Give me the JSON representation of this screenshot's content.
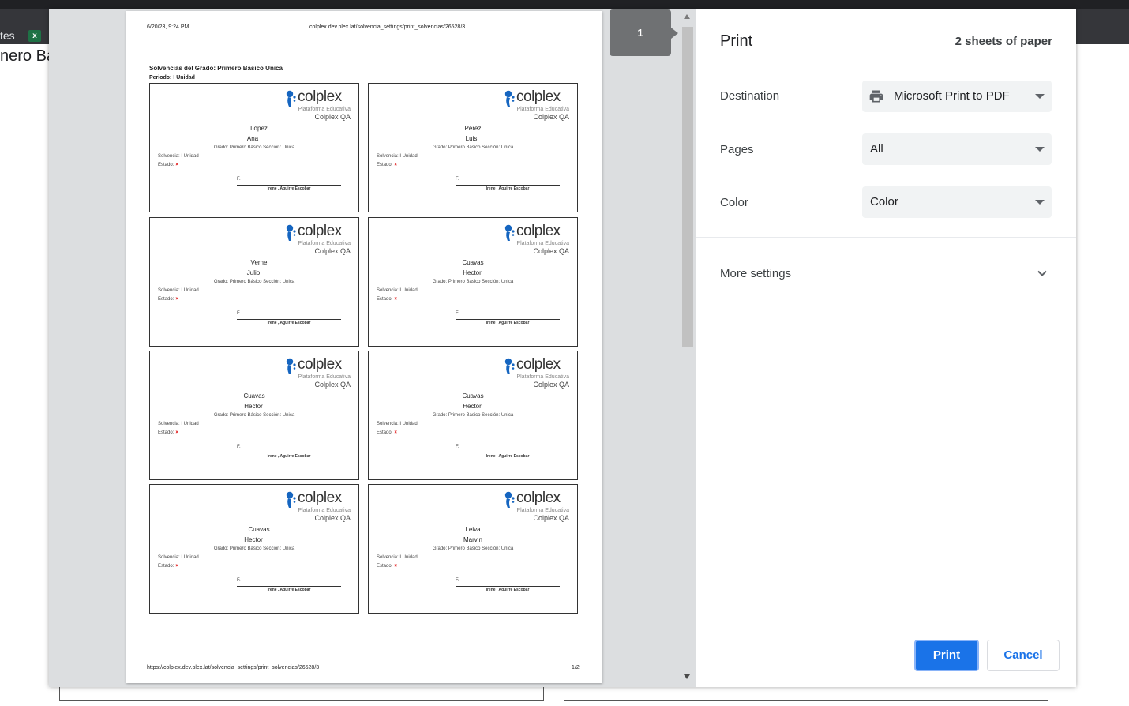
{
  "background": {
    "bookmark_text": "tes",
    "excel_icon_letter": "x",
    "heading_fragment": "nero Bá"
  },
  "preview": {
    "header_date": "6/20/23, 9:24 PM",
    "header_url": "colplex.dev.plex.lat/solvencia_settings/print_solvencias/26528/3",
    "title": "Solvencias del Grado: Primero Básico Unica",
    "period": "Periodo: I Unidad",
    "footer_url": "https://colplex.dev.plex.lat/solvencia_settings/print_solvencias/26528/3",
    "footer_page": "1/2",
    "page_badge": "1",
    "cards": [
      {
        "last": "López",
        "first": "Ana"
      },
      {
        "last": "Pérez",
        "first": "Luis"
      },
      {
        "last": "Verne",
        "first": "Julio"
      },
      {
        "last": "Cuavas",
        "first": "Hector"
      },
      {
        "last": "Cuavas",
        "first": "Hector"
      },
      {
        "last": "Cuavas",
        "first": "Hector"
      },
      {
        "last": "Cuavas",
        "first": "Hector"
      },
      {
        "last": "Leiva",
        "first": "Marvin"
      }
    ],
    "card_common": {
      "logo_word": "colplex",
      "logo_sub": "Plataforma Educativa",
      "school": "Colplex QA",
      "grade": "Grado: Primero Básico Sección: Unica",
      "solvencia": "Solvencia: I Unidad",
      "estado": "Estado:",
      "estado_mark": "×",
      "f_label": "F.",
      "signer": "Irene , Aguirre Escobar"
    }
  },
  "settings": {
    "title": "Print",
    "sheets": "2 sheets of paper",
    "destination_label": "Destination",
    "destination_value": "Microsoft Print to PDF",
    "pages_label": "Pages",
    "pages_value": "All",
    "color_label": "Color",
    "color_value": "Color",
    "more_settings": "More settings",
    "print_button": "Print",
    "cancel_button": "Cancel"
  },
  "colors": {
    "primary_blue": "#1a73e8",
    "logo_blue": "#1565c0",
    "error_red": "#d00000"
  }
}
